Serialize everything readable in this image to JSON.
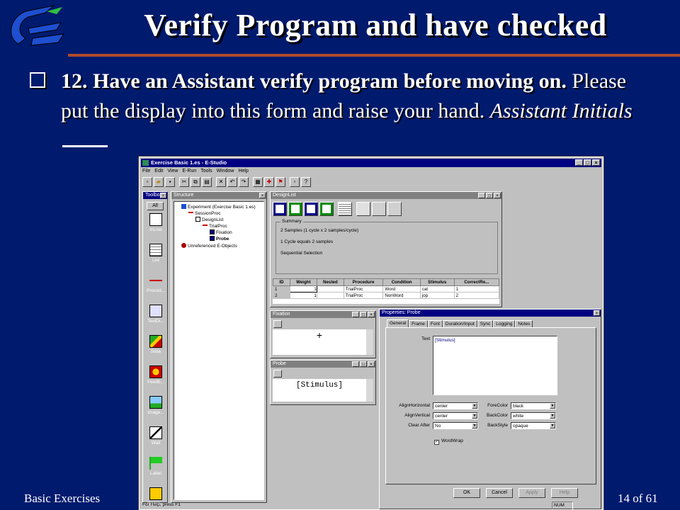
{
  "slide": {
    "title": "Verify Program and have checked",
    "bullet_number": "12.",
    "bullet_bold": "Have an Assistant verify program before moving on.",
    "bullet_normal": "Please put the display into this form and raise your hand.",
    "bullet_italic": "Assistant Initials",
    "footer_left": "Basic Exercises",
    "footer_right": "14 of  61"
  },
  "app": {
    "title": "Exercise Basic 1.es - E-Studio",
    "menu": [
      "File",
      "Edit",
      "View",
      "E-Run",
      "Tools",
      "Window",
      "Help"
    ],
    "status": "For Help, press F1",
    "status_num": "NUM"
  },
  "toolbox": {
    "title": "Toolbox",
    "all_label": "All",
    "items": [
      "InLine",
      "List",
      "Proced...",
      "TextDi...",
      "Slide",
      "Feedb...",
      "Image...",
      "Wait",
      "Label",
      "Packa..."
    ]
  },
  "structure": {
    "title": "Structure",
    "nodes": [
      "Experiment (Exercise Basic 1.es)",
      "SessionProc",
      "DesignList",
      "TrialProc",
      "Fixation",
      "Probe",
      "Unreferenced E-Objects"
    ]
  },
  "designlist": {
    "title": "DesignList",
    "summary_label": "Summary",
    "summary_lines": [
      "2 Samples (1 cycle x 2 samples/cycle)",
      "1 Cycle equals 2 samples",
      "Sequential Selection"
    ],
    "columns": [
      "ID",
      "Weight",
      "Nested",
      "Procedure",
      "Condition",
      "Stimulus",
      "CorrectRe..."
    ],
    "rows": [
      [
        "1",
        "1",
        "",
        "TrialProc",
        "Word",
        "cat",
        "1"
      ],
      [
        "2",
        "1",
        "",
        "TrialProc",
        "NonWord",
        "jop",
        "2"
      ]
    ]
  },
  "fixation": {
    "title": "Fixation",
    "content": "+"
  },
  "probe": {
    "title": "Probe",
    "content": "[Stimulus]"
  },
  "properties": {
    "title": "Properties: Probe",
    "tabs": [
      "General",
      "Frame",
      "Font",
      "Duration/Input",
      "Sync",
      "Logging",
      "Notes"
    ],
    "text_label": "Text",
    "text_value": "[Stimulus]",
    "align_h_label": "AlignHorizontal",
    "align_h_value": "center",
    "align_v_label": "AlignVertical",
    "align_v_value": "center",
    "clear_after_label": "Clear After",
    "clear_after_value": "No",
    "fore_label": "ForeColor",
    "fore_value": "black",
    "back_label": "BackColor",
    "back_value": "white",
    "backstyle_label": "BackStyle",
    "backstyle_value": "opaque",
    "wordwrap_label": "WordWrap",
    "buttons": [
      "OK",
      "Cancel",
      "Apply",
      "Help"
    ]
  },
  "colors": {
    "slide_bg": "#001a6e",
    "rule": "#b04a2a",
    "window_face": "#c0c0c0",
    "titlebar": "#000080"
  }
}
